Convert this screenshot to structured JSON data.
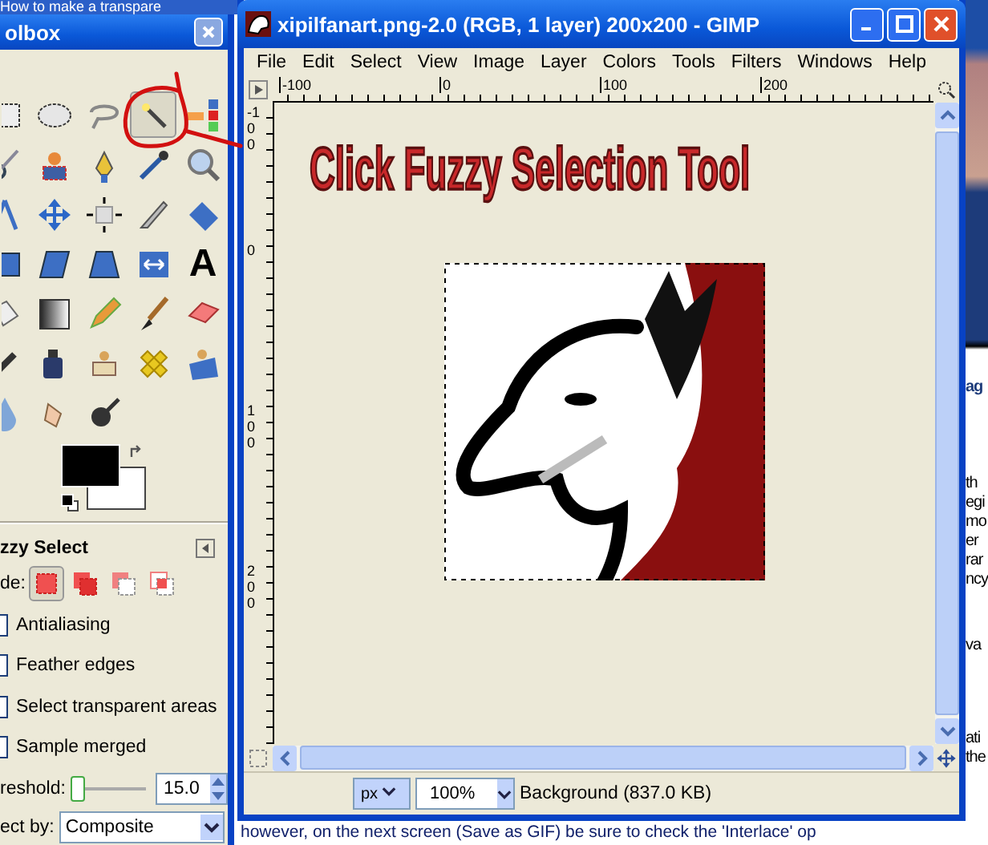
{
  "browser_page": {
    "title": "How to make a transpare",
    "side_fragments": [
      "ag",
      "th",
      "egi",
      "mo",
      "er",
      "rar",
      "ncy",
      "va",
      "ati",
      "the"
    ],
    "bottom_line": "however, on the next screen (Save as GIF) be sure to check the 'Interlace' op"
  },
  "toolbox": {
    "title": "olbox",
    "text_tool_glyph": "A",
    "tools": [
      {
        "selected": false
      },
      {
        "selected": false
      },
      {
        "selected": false
      },
      {
        "selected": true
      },
      {
        "selected": false
      },
      {
        "selected": false
      },
      {
        "selected": false
      },
      {
        "selected": false
      },
      {
        "selected": false
      },
      {
        "selected": false
      },
      {
        "selected": false
      },
      {
        "selected": false
      },
      {
        "selected": false
      },
      {
        "selected": false
      },
      {
        "selected": false
      },
      {
        "selected": false
      },
      {
        "selected": false
      },
      {
        "selected": false
      },
      {
        "selected": false
      },
      {
        "selected": false
      },
      {
        "selected": false
      },
      {
        "selected": false
      },
      {
        "selected": false
      },
      {
        "selected": false
      },
      {
        "selected": false
      },
      {
        "selected": false
      },
      {
        "selected": false
      },
      {
        "selected": false
      },
      {
        "selected": false
      },
      {
        "selected": false
      },
      {
        "selected": false
      },
      {
        "selected": false
      },
      {
        "selected": false
      }
    ],
    "tool_options": {
      "title": "zzy Select",
      "mode_label": "de:",
      "modes": [
        {
          "selected": true
        },
        {
          "selected": false
        },
        {
          "selected": false
        },
        {
          "selected": false
        }
      ],
      "checkboxes": [
        {
          "label": "Antialiasing",
          "checked": false
        },
        {
          "label": "Feather edges",
          "checked": false
        },
        {
          "label": "Select transparent areas",
          "checked": false
        },
        {
          "label": "Sample merged",
          "checked": false
        }
      ],
      "threshold": {
        "label": "reshold:",
        "level": 0.06,
        "value": "15.0"
      },
      "select_by": {
        "label": "ect by:",
        "value": "Composite"
      }
    }
  },
  "image_window": {
    "title": "xipilfanart.png-2.0 (RGB, 1 layer) 200x200 - GIMP",
    "menu": [
      "File",
      "Edit",
      "Select",
      "View",
      "Image",
      "Layer",
      "Colors",
      "Tools",
      "Filters",
      "Windows",
      "Help"
    ],
    "hruler": [
      "-100",
      "0",
      "100",
      "200"
    ],
    "vruler": [
      "-100",
      "0",
      "100",
      "200"
    ],
    "canvas_caption": "Click Fuzzy Selection Tool",
    "status": {
      "unit": "px",
      "zoom": "100%",
      "info": "Background (837.0 KB)"
    }
  }
}
